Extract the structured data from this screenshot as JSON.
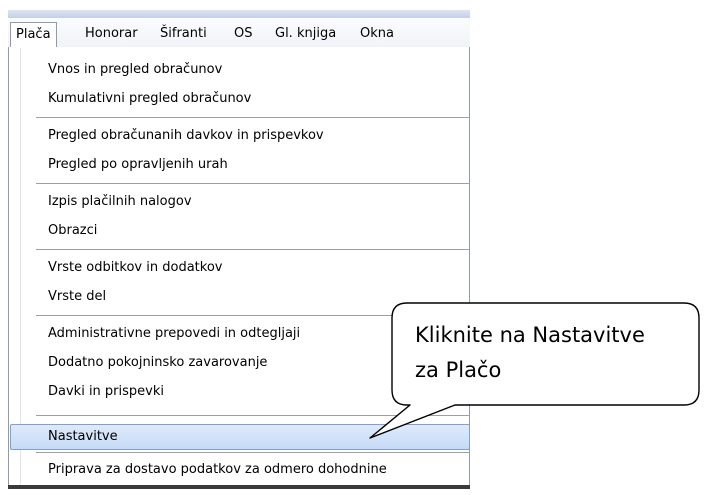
{
  "menubar": {
    "items": [
      {
        "label": "Plača"
      },
      {
        "label": "Honorar"
      },
      {
        "label": "Šifranti"
      },
      {
        "label": "OS"
      },
      {
        "label": "Gl. knjiga"
      },
      {
        "label": "Okna"
      }
    ]
  },
  "menu": {
    "items": [
      {
        "label": "Vnos in pregled obračunov"
      },
      {
        "label": "Kumulativni pregled obračunov"
      },
      {
        "label": "Pregled obračunanih davkov in prispevkov"
      },
      {
        "label": "Pregled po opravljenih urah"
      },
      {
        "label": "Izpis plačilnih nalogov"
      },
      {
        "label": "Obrazci"
      },
      {
        "label": "Vrste odbitkov in dodatkov"
      },
      {
        "label": "Vrste del"
      },
      {
        "label": "Administrativne prepovedi in odtegljaji"
      },
      {
        "label": "Dodatno pokojninsko zavarovanje"
      },
      {
        "label": "Davki in prispevki"
      },
      {
        "label": "Nastavitve"
      },
      {
        "label": "Priprava za dostavo podatkov za odmero dohodnine"
      }
    ],
    "highlighted": "Nastavitve"
  },
  "callout": {
    "line1": "Kliknite na Nastavitve",
    "line2": "za Plačo"
  },
  "colors": {
    "highlight": "#c6daf6",
    "highlight_border": "#7da2ce"
  }
}
